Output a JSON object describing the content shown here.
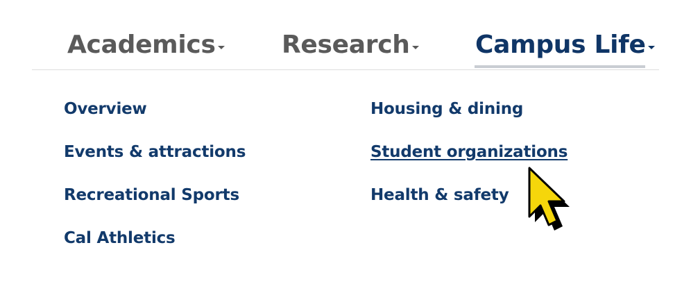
{
  "nav": {
    "tabs": [
      {
        "label": "Academics",
        "active": false
      },
      {
        "label": "Research",
        "active": false
      },
      {
        "label": "Campus Life",
        "active": true
      }
    ]
  },
  "dropdown": {
    "columns": [
      [
        {
          "label": "Overview"
        },
        {
          "label": "Events & attractions"
        },
        {
          "label": "Recreational Sports"
        },
        {
          "label": "Cal Athletics"
        }
      ],
      [
        {
          "label": "Housing & dining"
        },
        {
          "label": "Student organizations",
          "hovered": true
        },
        {
          "label": "Health & safety"
        }
      ]
    ]
  },
  "colors": {
    "nav_inactive": "#5a5a5a",
    "nav_active": "#0f3566",
    "link": "#123a6b",
    "cursor_fill": "#f5d60b"
  },
  "cursor": {
    "icon": "mouse-pointer-icon"
  }
}
